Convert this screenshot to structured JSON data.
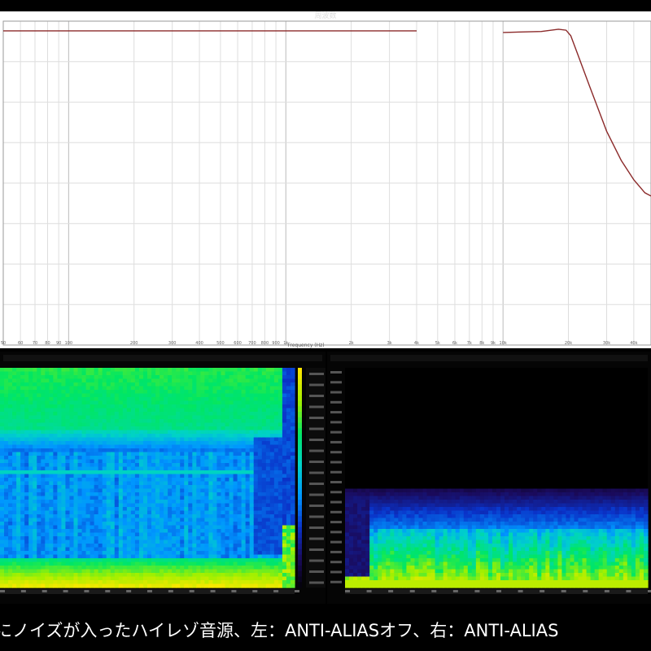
{
  "figure": {
    "title": "周波数",
    "caption": "にノイズが入ったハイレゾ音源、左：ANTI-ALIASオフ、右：ANTI-ALIAS"
  },
  "chart_data": [
    {
      "type": "line",
      "title": "",
      "xlabel": "Frequency (Hz)",
      "ylabel": "",
      "xscale": "log",
      "xlim": [
        50,
        48000
      ],
      "ylim": [
        0,
        1
      ],
      "grid": true,
      "x_ticks": [
        "50",
        "60",
        "70",
        "80",
        "90",
        "100",
        "200",
        "300",
        "400",
        "500",
        "600",
        "700",
        "800",
        "900",
        "1k",
        "2k",
        "3k",
        "4k",
        "5k",
        "6k",
        "7k",
        "8k",
        "9k",
        "10k",
        "20k",
        "30k",
        "40k"
      ],
      "series": [
        {
          "color": "#8b2a2a",
          "x": [
            50,
            100,
            1000,
            2000,
            4000,
            6000,
            10000,
            15000,
            18000,
            19500,
            20500,
            22000,
            25000,
            30000,
            35000,
            40000,
            45000,
            48000
          ],
          "y": [
            0.97,
            0.97,
            0.97,
            0.97,
            0.97,
            null,
            0.965,
            0.968,
            0.975,
            0.972,
            0.955,
            0.9,
            0.8,
            0.66,
            0.57,
            0.51,
            0.47,
            0.46
          ]
        }
      ]
    },
    {
      "type": "heatmap",
      "title": "",
      "colorbar": true,
      "colors": [
        "#000000",
        "#1a0a5a",
        "#0a32c8",
        "#0096ff",
        "#00d2c8",
        "#00e664",
        "#a0f000",
        "#ffe600"
      ]
    },
    {
      "type": "heatmap",
      "title": "",
      "colors": [
        "#000000",
        "#1a0a5a",
        "#0a32c8",
        "#0096ff",
        "#00d2c8",
        "#00e664",
        "#a0f000",
        "#ffe600"
      ]
    }
  ]
}
